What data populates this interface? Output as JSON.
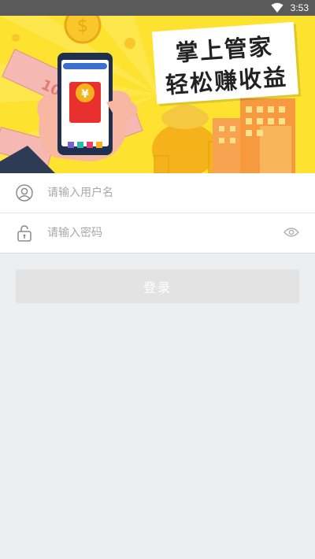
{
  "status_bar": {
    "time": "3:53",
    "wifi_icon": "wifi-icon"
  },
  "banner": {
    "slogan_line1": "掌上管家",
    "slogan_line2": "轻松赚收益",
    "note_text": "100",
    "coin_symbol": "¥",
    "dollar_symbol": "$",
    "colors": {
      "background": "#fde330",
      "accent_red": "#e8312f",
      "gold": "#f5b21a"
    }
  },
  "form": {
    "username_placeholder": "请输入用户名",
    "password_placeholder": "请输入密码",
    "username_icon": "user-icon",
    "password_icon": "lock-icon",
    "visibility_icon": "eye-icon"
  },
  "login_button": {
    "label": "登录"
  }
}
